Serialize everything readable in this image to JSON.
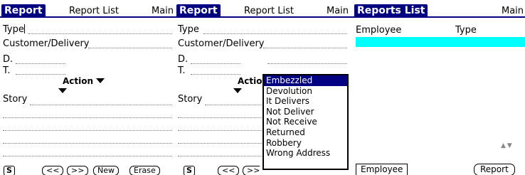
{
  "screen1": {
    "title": "Report",
    "menus": [
      "Report List",
      "Main"
    ],
    "fields": {
      "type": "Type",
      "customer": "Customer/Delivery",
      "d": "D.",
      "t": "T.",
      "action": "Action",
      "story": "Story"
    },
    "buttons": {
      "s": "S",
      "prev": "<<",
      "next": ">>",
      "new": "New",
      "erase": "Erase"
    }
  },
  "screen2": {
    "title": "Report",
    "menus": [
      "Report List",
      "Main"
    ],
    "fields": {
      "type": "Type",
      "customer": "Customer/Delivery",
      "d": "D.",
      "t": "T.",
      "action": "Actio",
      "story": "Story"
    },
    "buttons": {
      "s": "S",
      "prev": "<<",
      "next": ">>"
    },
    "dropdown": {
      "selected_index": 0,
      "options": [
        "Embezzled",
        "Devolution",
        "It Delivers",
        "Not Deliver",
        "Not Receive",
        "Returned",
        "Robbery",
        "Wrong Address"
      ]
    }
  },
  "screen3": {
    "title": "Reports List",
    "menus": [
      "Main"
    ],
    "columns": [
      "Employee",
      "Type"
    ],
    "buttons": {
      "employee": "Employee",
      "report": "Report"
    }
  },
  "colors": {
    "titlebar": "#000080",
    "selection": "#00ffff"
  }
}
